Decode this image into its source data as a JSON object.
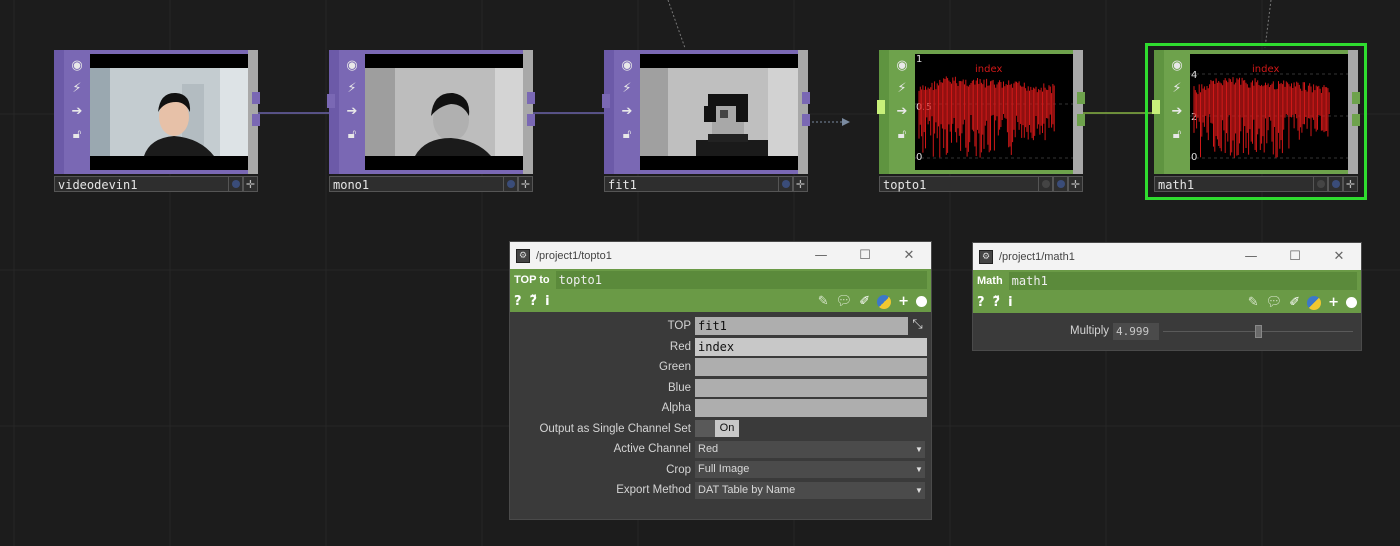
{
  "nodes": [
    {
      "name": "videodevin1",
      "family": "TOP",
      "kind": "camera"
    },
    {
      "name": "mono1",
      "family": "TOP",
      "kind": "mono"
    },
    {
      "name": "fit1",
      "family": "TOP",
      "kind": "pixel"
    },
    {
      "name": "topto1",
      "family": "CHOP",
      "kind": "chart",
      "chart_label": "index",
      "axis": [
        "1",
        "0.5",
        "0"
      ]
    },
    {
      "name": "math1",
      "family": "CHOP",
      "kind": "chart",
      "chart_label": "index",
      "axis": [
        "4",
        "2",
        "0"
      ],
      "selected": true
    }
  ],
  "node_flag_icons": [
    "viewer-icon",
    "bypass-icon",
    "display-icon",
    "lock-icon"
  ],
  "topto_panel": {
    "title": "/project1/topto1",
    "op_type": "TOP to",
    "op_name": "topto1",
    "params": {
      "top_label": "TOP",
      "top_value": "fit1",
      "red_label": "Red",
      "red_value": "index",
      "green_label": "Green",
      "green_value": "",
      "blue_label": "Blue",
      "blue_value": "",
      "alpha_label": "Alpha",
      "alpha_value": "",
      "single_label": "Output as Single Channel Set",
      "single_value": "On",
      "active_label": "Active Channel",
      "active_value": "Red",
      "crop_label": "Crop",
      "crop_value": "Full Image",
      "export_label": "Export Method",
      "export_value": "DAT Table by Name"
    }
  },
  "math_panel": {
    "title": "/project1/math1",
    "op_type": "Math",
    "op_name": "math1",
    "multiply_label": "Multiply",
    "multiply_value": "4.999",
    "multiply_fraction": 0.5
  },
  "colors": {
    "top_family": "#7a68b4",
    "chop_family": "#6ea24c",
    "selection": "#2fdc2f",
    "chart_trace": "#d01818"
  }
}
